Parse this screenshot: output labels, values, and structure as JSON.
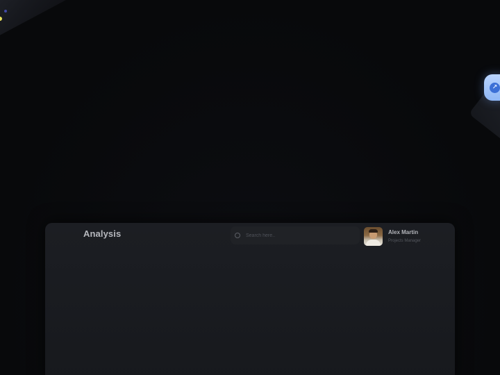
{
  "header": {
    "title": "Analysis"
  },
  "search": {
    "placeholder": "Search here.."
  },
  "user": {
    "name": "Alex Martin",
    "role": "Projects Manager"
  },
  "decorations": {
    "badge_icon": "arrow-icon",
    "badge_color": "#a9c8fb",
    "accent_yellow": "#e8e15a"
  }
}
